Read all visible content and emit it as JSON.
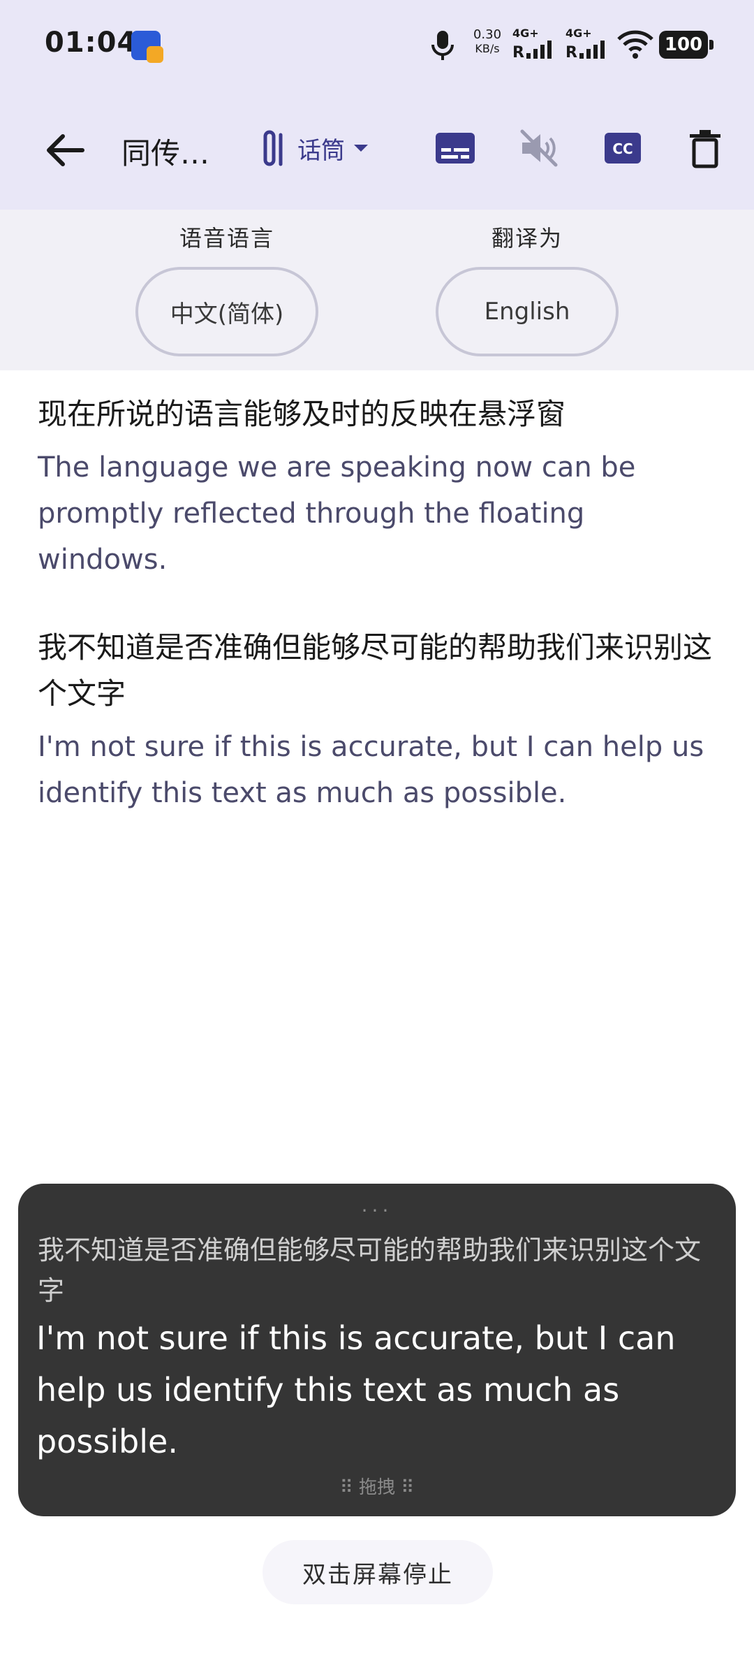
{
  "status_bar": {
    "time": "01:04",
    "net_speed_value": "0.30",
    "net_speed_unit": "KB/s",
    "sim1_label": "4G+",
    "sim2_label": "4G+",
    "battery": "100"
  },
  "toolbar": {
    "title": "同传…",
    "mode_label": "话筒",
    "icons": [
      "back-arrow-icon",
      "microphone-mode-icon",
      "chevron-down-icon",
      "subtitles-icon",
      "speaker-muted-icon",
      "closed-caption-icon",
      "trash-icon"
    ]
  },
  "languages": {
    "source_caption": "语音语言",
    "source_value": "中文(简体)",
    "target_caption": "翻译为",
    "target_value": "English"
  },
  "transcript": [
    {
      "source": "现在所说的语言能够及时的反映在悬浮窗",
      "translation": "The language we are speaking now can be promptly reflected through the floating windows."
    },
    {
      "source": "我不知道是否准确但能够尽可能的帮助我们来识别这个文字",
      "translation": "I'm not sure if this is accurate, but I can help us identify this text as much as possible."
    }
  ],
  "floating_window": {
    "handle": "···",
    "source": "我不知道是否准确但能够尽可能的帮助我们来识别这个文字",
    "translation": "I'm not sure if this is accurate, but I can help us identify this text as much as possible.",
    "drag_label": "⠿ 拖拽 ⠿"
  },
  "stop_hint": "双击屏幕停止",
  "colors": {
    "header_bg": "#e9e7f7",
    "accent": "#3b3a8c",
    "float_bg": "#353535"
  }
}
